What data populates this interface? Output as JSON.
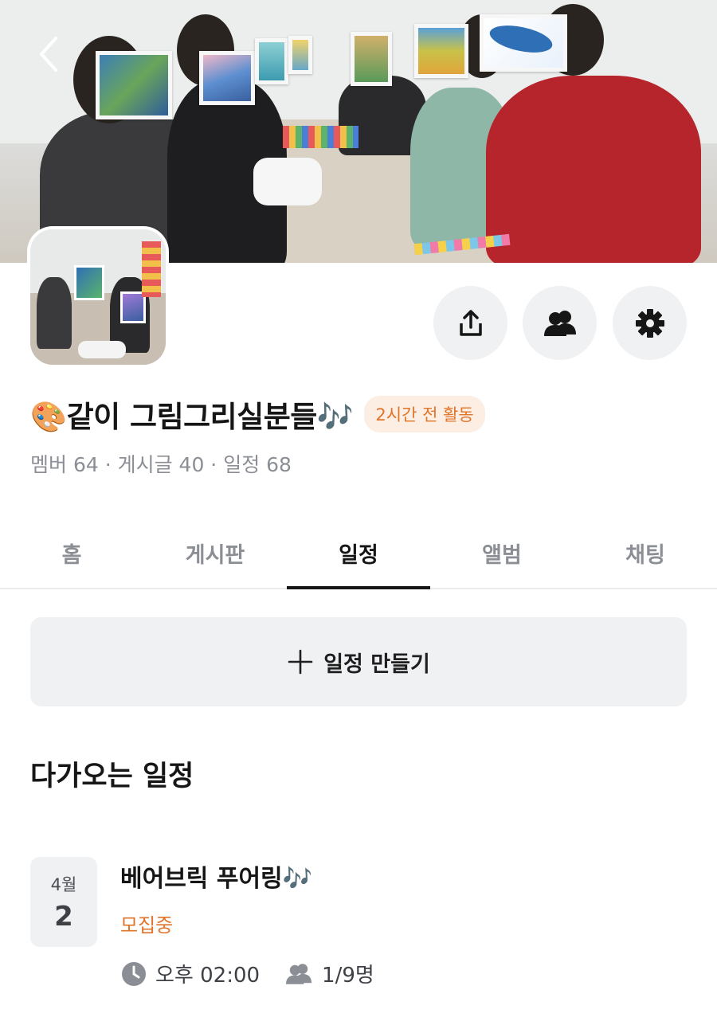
{
  "group": {
    "title": "🎨같이 그림그리실분들🎶",
    "activity_badge": "2시간 전 활동",
    "stats": "멤버 64 · 게시글 40 · 일정 68"
  },
  "tabs": [
    {
      "label": "홈"
    },
    {
      "label": "게시판"
    },
    {
      "label": "일정",
      "active": true
    },
    {
      "label": "앨범"
    },
    {
      "label": "채팅"
    }
  ],
  "create_schedule": {
    "label": "일정 만들기"
  },
  "upcoming": {
    "section_title": "다가오는 일정",
    "events": [
      {
        "month": "4월",
        "day": "2",
        "title": "베어브릭 푸어링🎶",
        "status": "모집중",
        "time": "오후 02:00",
        "participants": "1/9명"
      }
    ]
  },
  "colors": {
    "accent": "#e0752a",
    "badge_bg": "#fdeee3",
    "button_bg": "#f0f1f3"
  },
  "icons": [
    "back-icon",
    "share-icon",
    "members-icon",
    "settings-icon",
    "plus-icon",
    "clock-icon",
    "people-icon"
  ]
}
